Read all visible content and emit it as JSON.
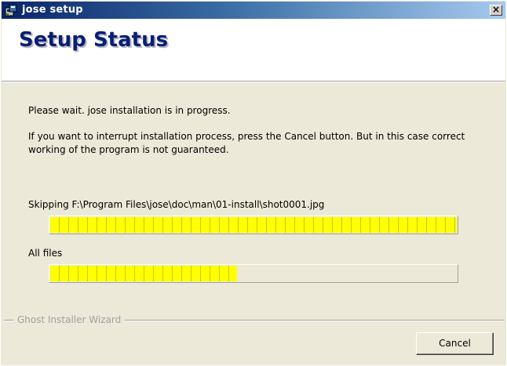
{
  "window": {
    "title": "jose setup",
    "close_glyph": "×"
  },
  "header": {
    "title": "Setup Status"
  },
  "body": {
    "message1": "Please wait. jose installation is in progress.",
    "message2": "If you want to interrupt installation process, press the Cancel button. But in this case correct working of the program is not guaranteed."
  },
  "progress": {
    "current_status": "Skipping F:\\Program Files\\jose\\doc\\man\\01-install\\shot0001.jpg",
    "current_fraction": 1.0,
    "overall_label": "All files",
    "overall_fraction": 0.46,
    "fill_color": "#ffff00"
  },
  "footer": {
    "group_label": "Ghost Installer Wizard",
    "cancel_label": "Cancel"
  },
  "icons": {
    "app": "installer-app-icon",
    "close": "close-icon"
  }
}
